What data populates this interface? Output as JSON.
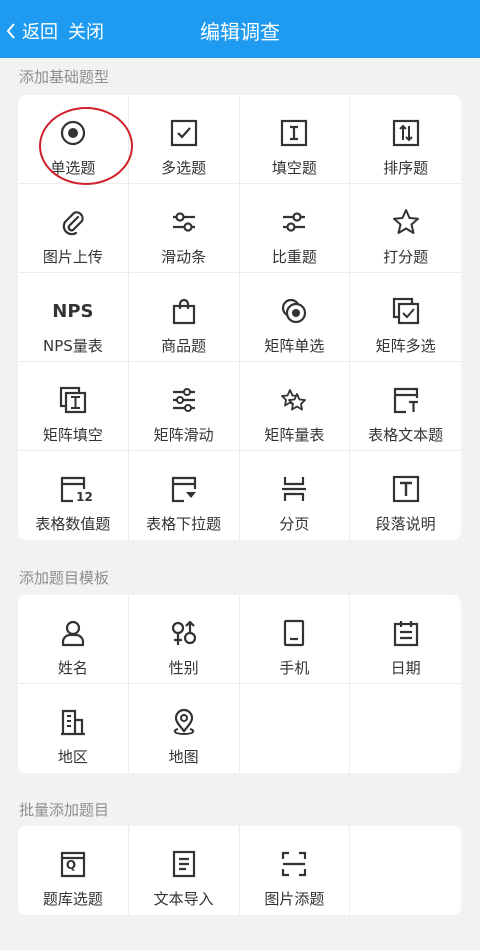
{
  "header": {
    "back_label": "返回",
    "close_label": "关闭",
    "title": "编辑调查"
  },
  "sections": {
    "basic": {
      "label": "添加基础题型",
      "items": [
        {
          "label": "单选题",
          "icon": "radio-icon"
        },
        {
          "label": "多选题",
          "icon": "checkbox-icon"
        },
        {
          "label": "填空题",
          "icon": "text-field-icon"
        },
        {
          "label": "排序题",
          "icon": "sort-icon"
        },
        {
          "label": "图片上传",
          "icon": "paperclip-icon"
        },
        {
          "label": "滑动条",
          "icon": "slider-icon"
        },
        {
          "label": "比重题",
          "icon": "weight-icon"
        },
        {
          "label": "打分题",
          "icon": "star-icon"
        },
        {
          "label": "NPS量表",
          "icon": "nps-icon",
          "icon_text": "NPS"
        },
        {
          "label": "商品题",
          "icon": "shopping-bag-icon"
        },
        {
          "label": "矩阵单选",
          "icon": "matrix-radio-icon"
        },
        {
          "label": "矩阵多选",
          "icon": "matrix-checkbox-icon"
        },
        {
          "label": "矩阵填空",
          "icon": "matrix-fill-icon"
        },
        {
          "label": "矩阵滑动",
          "icon": "matrix-slider-icon"
        },
        {
          "label": "矩阵量表",
          "icon": "matrix-scale-icon"
        },
        {
          "label": "表格文本题",
          "icon": "table-text-icon"
        },
        {
          "label": "表格数值题",
          "icon": "table-number-icon",
          "icon_text": "12"
        },
        {
          "label": "表格下拉题",
          "icon": "table-dropdown-icon"
        },
        {
          "label": "分页",
          "icon": "page-break-icon"
        },
        {
          "label": "段落说明",
          "icon": "paragraph-icon",
          "icon_text": "T"
        }
      ]
    },
    "templates": {
      "label": "添加题目模板",
      "items": [
        {
          "label": "姓名",
          "icon": "person-icon"
        },
        {
          "label": "性别",
          "icon": "gender-icon"
        },
        {
          "label": "手机",
          "icon": "phone-icon"
        },
        {
          "label": "日期",
          "icon": "calendar-icon"
        },
        {
          "label": "地区",
          "icon": "building-icon"
        },
        {
          "label": "地图",
          "icon": "map-pin-icon"
        }
      ]
    },
    "batch": {
      "label": "批量添加题目",
      "items": [
        {
          "label": "题库选题",
          "icon": "question-bank-icon",
          "icon_text": "Q"
        },
        {
          "label": "文本导入",
          "icon": "document-icon"
        },
        {
          "label": "图片添题",
          "icon": "scan-icon"
        }
      ]
    }
  },
  "colors": {
    "header": "#1e9bf0",
    "annotation_circle": "#d0202a"
  }
}
